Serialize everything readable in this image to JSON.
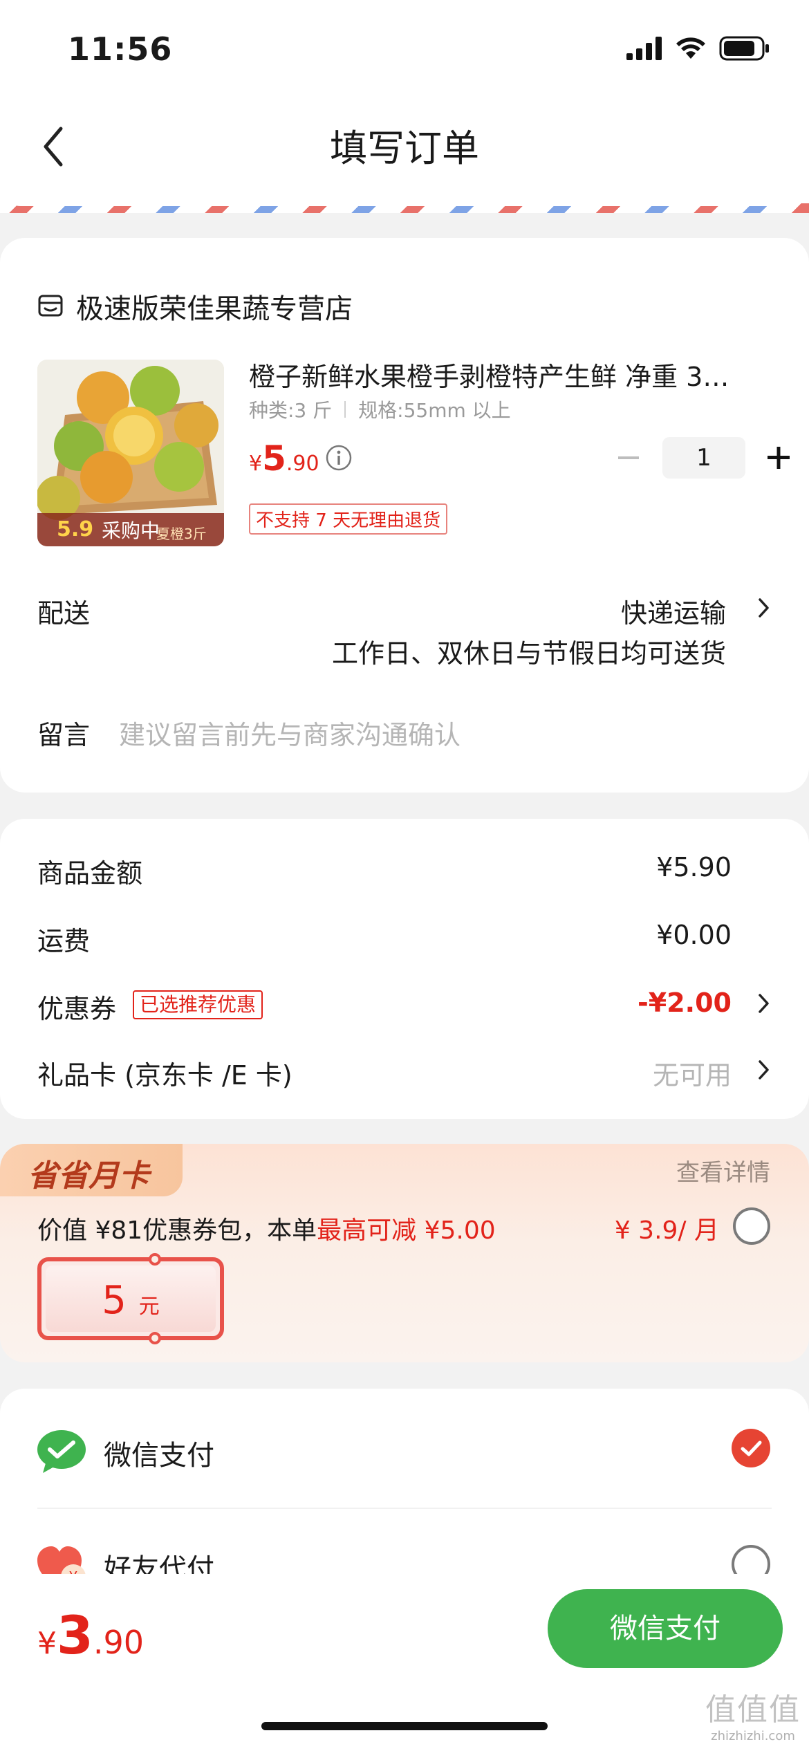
{
  "status_bar": {
    "time": "11:56"
  },
  "nav": {
    "title": "填写订单"
  },
  "store": {
    "name": "极速版荣佳果蔬专营店"
  },
  "product": {
    "title": "橙子新鲜水果橙手剥橙特产生鲜 净重 3…",
    "spec_type": "种类:3 斤",
    "spec_size": "规格:55mm 以上",
    "price_currency": "¥",
    "price_int": "5",
    "price_dec": ".90",
    "quantity": "1",
    "image_overlay": "采购中",
    "image_banner_price": "5.9",
    "image_banner_text": "夏橙3斤",
    "return_policy": "不支持 7 天无理由退货"
  },
  "delivery": {
    "label": "配送",
    "method": "快递运输",
    "note": "工作日、双休日与节假日均可送货"
  },
  "memo": {
    "label": "留言",
    "placeholder": "建议留言前先与商家沟通确认"
  },
  "amounts": {
    "goods_label": "商品金额",
    "goods_value": "¥5.90",
    "shipping_label": "运费",
    "shipping_value": "¥0.00",
    "coupon_label": "优惠券",
    "coupon_tag": "已选推荐优惠",
    "coupon_value": "-¥2.00",
    "giftcard_label": "礼品卡 (京东卡 /E 卡)",
    "giftcard_value": "无可用"
  },
  "monthly_card": {
    "badge": "省省月卡",
    "detail_link": "查看详情",
    "desc_prefix": "价值 ¥81优惠券包，本单",
    "desc_highlight": "最高可减 ¥5.00",
    "price": "¥ 3.9/ 月",
    "voucher_amount": "5",
    "voucher_unit": "元"
  },
  "payment": {
    "wechat_label": "微信支付",
    "friend_label": "好友代付"
  },
  "bottom": {
    "total_currency": "¥",
    "total_int": "3",
    "total_dec": ".90",
    "pay_button": "微信支付"
  },
  "watermark": {
    "logo": "值值值",
    "url": "zhizhizhi.com"
  },
  "colors": {
    "accent_red": "#e2231a",
    "wechat_green": "#3fb34f",
    "airmail_red": "#e8716a",
    "airmail_blue": "#7ea3e6"
  }
}
